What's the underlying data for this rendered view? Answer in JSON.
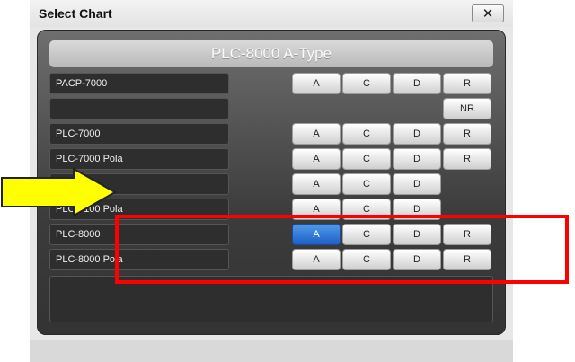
{
  "dialog": {
    "title": "Select Chart",
    "close_label": "✕"
  },
  "header": {
    "title": "PLC-8000 A-Type"
  },
  "rows": [
    {
      "name": "PACP-7000",
      "buttons": [
        "A",
        "C",
        "D",
        "R"
      ]
    },
    {
      "name": "",
      "buttons": [
        "NR"
      ]
    },
    {
      "name": "PLC-7000",
      "buttons": [
        "A",
        "C",
        "D",
        "R"
      ]
    },
    {
      "name": "PLC-7000 Pola",
      "buttons": [
        "A",
        "C",
        "D",
        "R"
      ]
    },
    {
      "name": "",
      "buttons": [
        "A",
        "C",
        "D"
      ]
    },
    {
      "name": "PLC-7100 Pola",
      "buttons": [
        "A",
        "C",
        "D"
      ]
    },
    {
      "name": "PLC-8000",
      "buttons": [
        "A",
        "C",
        "D",
        "R"
      ],
      "selected_button": "A"
    },
    {
      "name": "PLC-8000 Pola",
      "buttons": [
        "A",
        "C",
        "D",
        "R"
      ]
    }
  ],
  "colors": {
    "selected_button": "#1e5fc8",
    "annotation_highlight": "#ff0000",
    "annotation_arrow": "#ffff00"
  }
}
